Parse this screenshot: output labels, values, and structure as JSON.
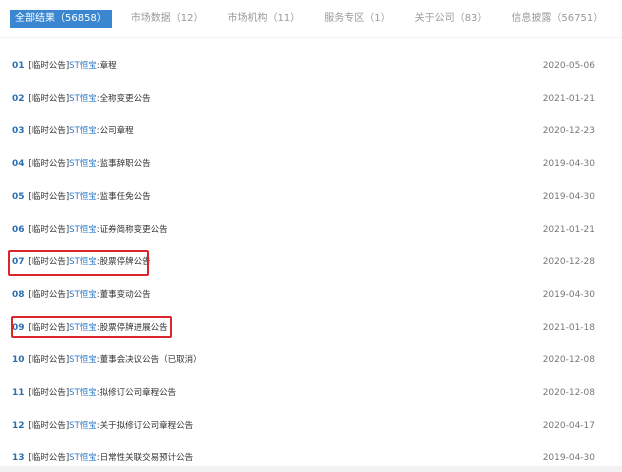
{
  "tabs": [
    {
      "label": "全部结果（56858）",
      "active": true
    },
    {
      "label": "市场数据（12）"
    },
    {
      "label": "市场机构（11）"
    },
    {
      "label": "服务专区（1）"
    },
    {
      "label": "关于公司（83）"
    },
    {
      "label": "信息披露（56751）"
    }
  ],
  "rows": [
    {
      "num": "01",
      "type": "[临时公告]",
      "company": "ST恒宝",
      "title": ":章程",
      "date": "2020-05-06"
    },
    {
      "num": "02",
      "type": "[临时公告]",
      "company": "ST恒宝",
      "title": ":全称变更公告",
      "date": "2021-01-21"
    },
    {
      "num": "03",
      "type": "[临时公告]",
      "company": "ST恒宝",
      "title": ":公司章程",
      "date": "2020-12-23"
    },
    {
      "num": "04",
      "type": "[临时公告]",
      "company": "ST恒宝",
      "title": ":监事辞职公告",
      "date": "2019-04-30"
    },
    {
      "num": "05",
      "type": "[临时公告]",
      "company": "ST恒宝",
      "title": ":监事任免公告",
      "date": "2019-04-30"
    },
    {
      "num": "06",
      "type": "[临时公告]",
      "company": "ST恒宝",
      "title": ":证券简称变更公告",
      "date": "2021-01-21"
    },
    {
      "num": "07",
      "type": "[临时公告]",
      "company": "ST恒宝",
      "title": ":股票停牌公告",
      "date": "2020-12-28"
    },
    {
      "num": "08",
      "type": "[临时公告]",
      "company": "ST恒宝",
      "title": ":董事变动公告",
      "date": "2019-04-30"
    },
    {
      "num": "09",
      "type": "[临时公告]",
      "company": "ST恒宝",
      "title": ":股票停牌进展公告",
      "date": "2021-01-18"
    },
    {
      "num": "10",
      "type": "[临时公告]",
      "company": "ST恒宝",
      "title": ":董事会决议公告（已取消）",
      "date": "2020-12-08"
    },
    {
      "num": "11",
      "type": "[临时公告]",
      "company": "ST恒宝",
      "title": ":拟修订公司章程公告",
      "date": "2020-12-08"
    },
    {
      "num": "12",
      "type": "[临时公告]",
      "company": "ST恒宝",
      "title": ":关于拟修订公司章程公告",
      "date": "2020-04-17"
    },
    {
      "num": "13",
      "type": "[临时公告]",
      "company": "ST恒宝",
      "title": ":日常性关联交易预计公告",
      "date": "2019-04-30"
    }
  ]
}
